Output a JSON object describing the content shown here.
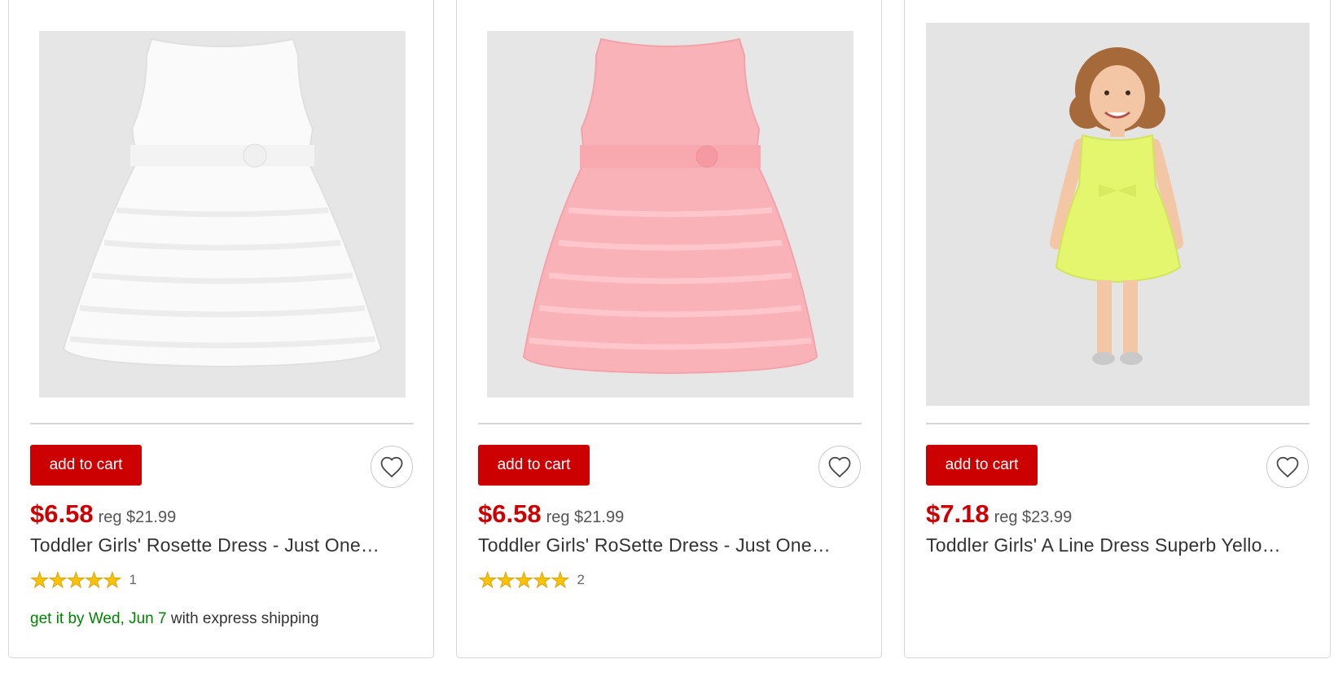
{
  "products": [
    {
      "image_alt": "",
      "cart_label": "add to cart",
      "price": "$6.58",
      "reg_price": "reg $21.99",
      "title": "Toddler Girls' Rosette Dress - Just One…",
      "stars": "★★★★★",
      "rating_count": "1",
      "shipping_prefix": "get it by Wed, Jun 7",
      "shipping_suffix": " with express shipping"
    },
    {
      "image_alt": "",
      "cart_label": "add to cart",
      "price": "$6.58",
      "reg_price": "reg $21.99",
      "title": "Toddler Girls' RoSette Dress - Just One…",
      "stars": "★★★★★",
      "rating_count": "2"
    },
    {
      "image_alt": "",
      "cart_label": "add to cart",
      "price": "$7.18",
      "reg_price": "reg $23.99",
      "title": "Toddler Girls' A Line Dress Superb Yello…"
    }
  ],
  "colors": {
    "brand_red": "#cc0000",
    "shipping_green": "#008300",
    "star_yellow": "#ffc200"
  },
  "icons": {
    "favorite": "heart-outline-icon",
    "rating": "star-icon"
  }
}
